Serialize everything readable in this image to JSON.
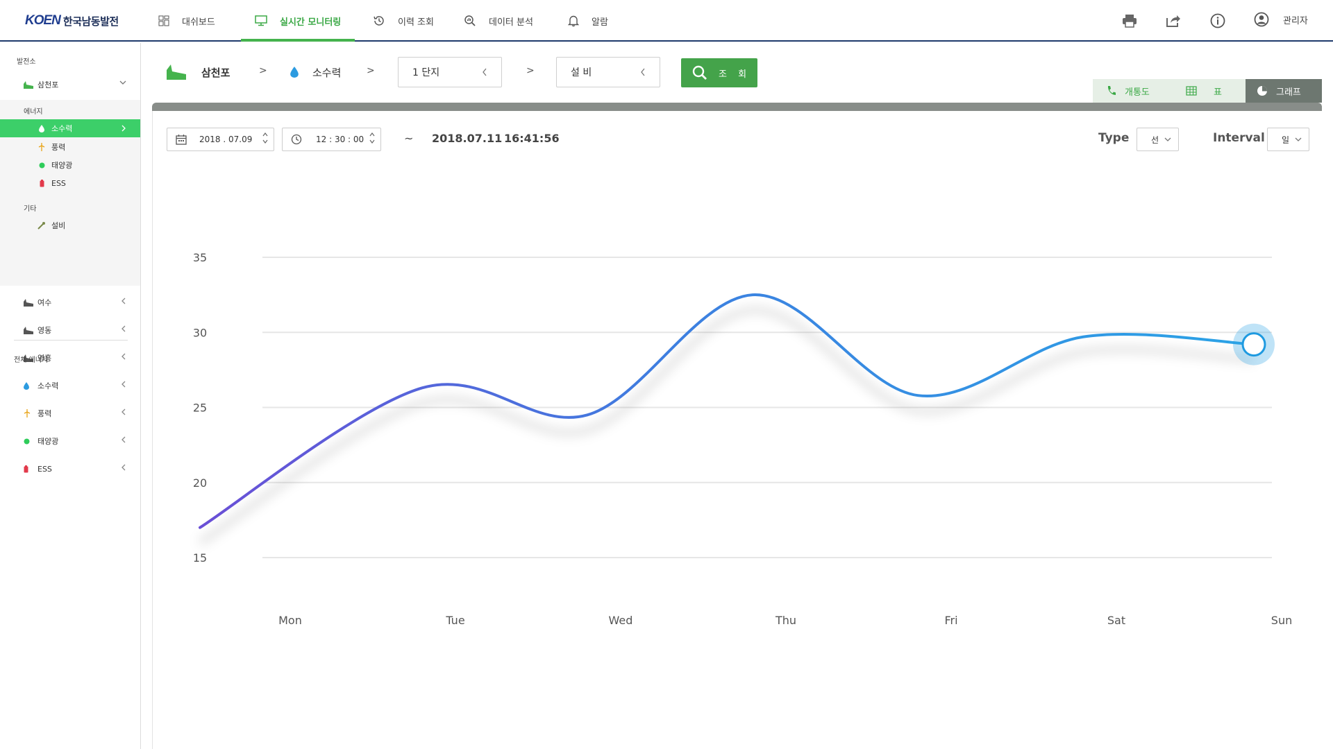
{
  "brand": {
    "logo_mark": "KOEN",
    "logo_text": "한국남동발전"
  },
  "nav": {
    "items": [
      {
        "label": "대쉬보드",
        "icon": "dashboard-icon"
      },
      {
        "label": "실시간 모니터링",
        "icon": "monitor-icon",
        "active": true
      },
      {
        "label": "이력 조회",
        "icon": "history-icon"
      },
      {
        "label": "데이터 분석",
        "icon": "analysis-icon"
      },
      {
        "label": "알람",
        "icon": "bell-icon"
      }
    ],
    "tools": [
      "print-icon",
      "share-icon",
      "info-icon"
    ],
    "user_label": "관리자"
  },
  "sidebar": {
    "section_plants": "발전소",
    "plant_selected": "삼천포",
    "group_energy": "에너지",
    "energy_items": [
      {
        "label": "소수력",
        "icon": "water-drop-icon",
        "active": true
      },
      {
        "label": "풍력",
        "icon": "wind-icon"
      },
      {
        "label": "태양광",
        "icon": "solar-icon"
      },
      {
        "label": "ESS",
        "icon": "battery-icon"
      }
    ],
    "group_etc": "기타",
    "etc_items": [
      {
        "label": "설비",
        "icon": "wrench-icon"
      }
    ],
    "other_plants": [
      "여수",
      "영동",
      "영흥"
    ],
    "section_all": "전체 에너지",
    "all_items": [
      {
        "label": "소수력",
        "icon": "water-drop-icon"
      },
      {
        "label": "풍력",
        "icon": "wind-icon"
      },
      {
        "label": "태양광",
        "icon": "solar-icon"
      },
      {
        "label": "ESS",
        "icon": "battery-icon"
      }
    ]
  },
  "breadcrumb": {
    "plant": "삼천포",
    "sep": ">",
    "energy": "소수력",
    "unit_select": "1 단지",
    "equip_select": "설 비",
    "search_label": "조 회"
  },
  "view_tabs": {
    "diagram": "개통도",
    "table": "표",
    "graph": "그래프"
  },
  "controls": {
    "date": "2018 . 07.09",
    "time": "12 : 30 : 00",
    "tilde": "~",
    "end_date": "2018.07.11",
    "end_time": "16:41:56",
    "type_label": "Type",
    "type_value": "선",
    "interval_label": "Interval",
    "interval_value": "일"
  },
  "colors": {
    "brand_green": "#45b34d",
    "active_green": "#3ccf69",
    "navy": "#1e3a6b",
    "line_start": "#6a4fd6",
    "line_end": "#2ba3e6"
  },
  "chart_data": {
    "type": "line",
    "categories": [
      "Mon",
      "Tue",
      "Wed",
      "Thu",
      "Fri",
      "Sat",
      "Sun"
    ],
    "x": [
      0,
      1,
      2,
      3,
      4,
      5,
      6
    ],
    "series": [
      {
        "values": [
          17,
          26.3,
          24.5,
          32.5,
          25.8,
          29.7,
          29.2
        ]
      }
    ],
    "y_ticks": [
      15,
      20,
      25,
      30,
      35
    ],
    "ylim": [
      15,
      35
    ],
    "grid": true
  }
}
